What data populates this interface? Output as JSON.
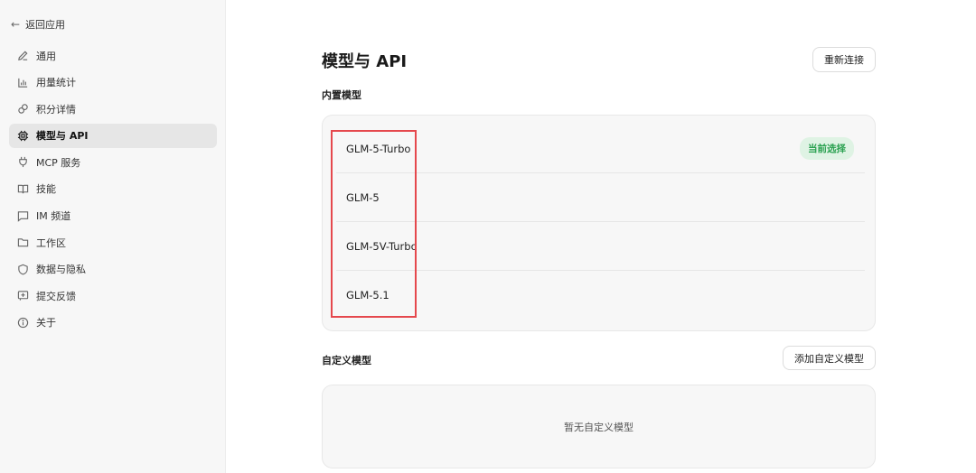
{
  "sidebar": {
    "back_label": "返回应用",
    "items": [
      {
        "label": "通用",
        "icon": "pencil-icon"
      },
      {
        "label": "用量统计",
        "icon": "bar-chart-icon"
      },
      {
        "label": "积分详情",
        "icon": "coins-icon"
      },
      {
        "label": "模型与 API",
        "icon": "chip-icon",
        "active": true
      },
      {
        "label": "MCP 服务",
        "icon": "plug-icon"
      },
      {
        "label": "技能",
        "icon": "book-icon"
      },
      {
        "label": "IM 频道",
        "icon": "chat-icon"
      },
      {
        "label": "工作区",
        "icon": "folder-icon"
      },
      {
        "label": "数据与隐私",
        "icon": "shield-icon"
      },
      {
        "label": "提交反馈",
        "icon": "feedback-icon"
      },
      {
        "label": "关于",
        "icon": "info-icon"
      }
    ]
  },
  "main": {
    "title": "模型与 API",
    "reconnect_label": "重新连接",
    "builtin": {
      "label": "内置模型",
      "models": [
        {
          "name": "GLM-5-Turbo",
          "badge": "当前选择"
        },
        {
          "name": "GLM-5"
        },
        {
          "name": "GLM-5V-Turbo"
        },
        {
          "name": "GLM-5.1"
        }
      ]
    },
    "custom": {
      "label": "自定义模型",
      "add_label": "添加自定义模型",
      "empty_text": "暂无自定义模型"
    }
  },
  "colors": {
    "accent_green": "#2aa150",
    "badge_bg": "#dff3e4",
    "highlight_red": "#e5484d",
    "active_bg": "#e6e6e6"
  }
}
